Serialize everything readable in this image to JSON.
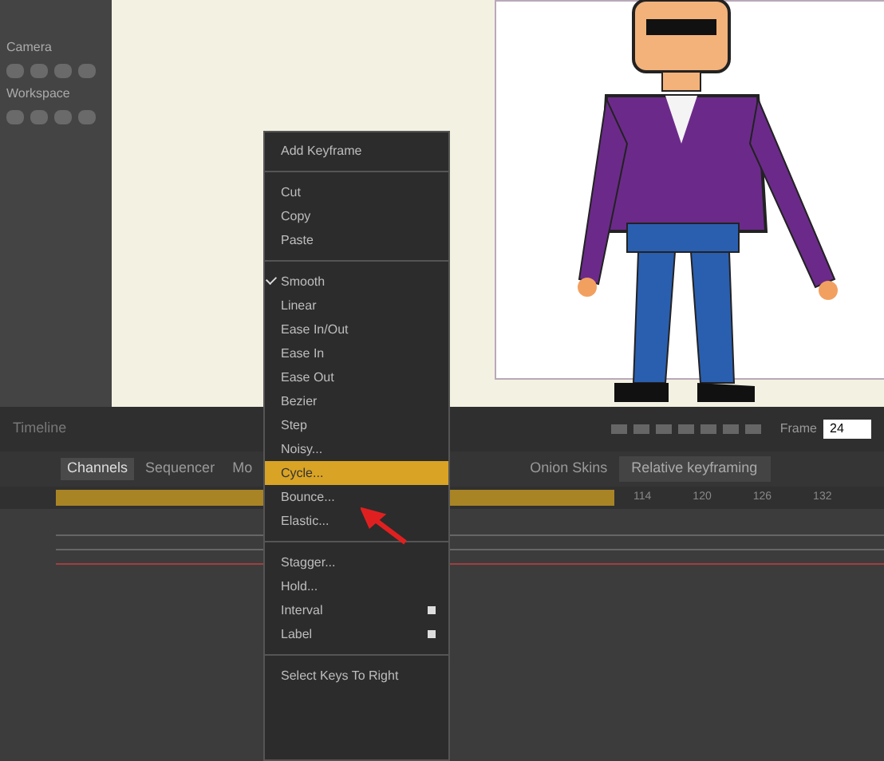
{
  "tools_panel": {
    "sections": [
      "Camera",
      "Workspace"
    ]
  },
  "timeline": {
    "title": "Timeline",
    "frame_label": "Frame",
    "frame_value": "24",
    "tabs": [
      {
        "label": "Channels",
        "selected": true
      },
      {
        "label": "Sequencer",
        "selected": false
      },
      {
        "label": "Mo",
        "selected": false
      }
    ],
    "onion_skins": "Onion Skins",
    "relative_keyframing": "Relative keyframing",
    "ruler": [
      "114",
      "120",
      "126",
      "132"
    ]
  },
  "context_menu": {
    "groups": [
      [
        {
          "label": "Add Keyframe",
          "checked": false,
          "selected": false,
          "submenu": false
        }
      ],
      [
        {
          "label": "Cut",
          "checked": false,
          "selected": false,
          "submenu": false
        },
        {
          "label": "Copy",
          "checked": false,
          "selected": false,
          "submenu": false
        },
        {
          "label": "Paste",
          "checked": false,
          "selected": false,
          "submenu": false
        }
      ],
      [
        {
          "label": "Smooth",
          "checked": true,
          "selected": false,
          "submenu": false
        },
        {
          "label": "Linear",
          "checked": false,
          "selected": false,
          "submenu": false
        },
        {
          "label": "Ease In/Out",
          "checked": false,
          "selected": false,
          "submenu": false
        },
        {
          "label": "Ease In",
          "checked": false,
          "selected": false,
          "submenu": false
        },
        {
          "label": "Ease Out",
          "checked": false,
          "selected": false,
          "submenu": false
        },
        {
          "label": "Bezier",
          "checked": false,
          "selected": false,
          "submenu": false
        },
        {
          "label": "Step",
          "checked": false,
          "selected": false,
          "submenu": false
        },
        {
          "label": "Noisy...",
          "checked": false,
          "selected": false,
          "submenu": false
        },
        {
          "label": "Cycle...",
          "checked": false,
          "selected": true,
          "submenu": false
        },
        {
          "label": "Bounce...",
          "checked": false,
          "selected": false,
          "submenu": false
        },
        {
          "label": "Elastic...",
          "checked": false,
          "selected": false,
          "submenu": false
        }
      ],
      [
        {
          "label": "Stagger...",
          "checked": false,
          "selected": false,
          "submenu": false
        },
        {
          "label": "Hold...",
          "checked": false,
          "selected": false,
          "submenu": false
        },
        {
          "label": "Interval",
          "checked": false,
          "selected": false,
          "submenu": true
        },
        {
          "label": "Label",
          "checked": false,
          "selected": false,
          "submenu": true
        }
      ],
      [
        {
          "label": "Select Keys To Right",
          "checked": false,
          "selected": false,
          "submenu": false
        }
      ]
    ]
  }
}
